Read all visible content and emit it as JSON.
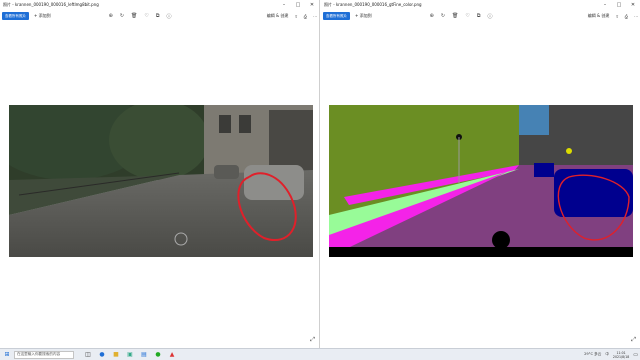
{
  "left_window": {
    "title": "照片 - krannen_000190_000016_leftImg8bit.png",
    "primary_button": "查看所有照片",
    "edit_label": "+ 添加到",
    "zoom_label": "编辑 & 创建",
    "share_label": "共享",
    "print_label": "打印"
  },
  "right_window": {
    "title": "照片 - krannen_000190_000016_gtFine_color.png",
    "primary_button": "查看所有照片",
    "edit_label": "+ 添加到",
    "zoom_label": "编辑 & 创建",
    "share_label": "共享",
    "print_label": "打印"
  },
  "icons": [
    "zoom-in-icon",
    "rotate-icon",
    "delete-icon",
    "favorite-icon",
    "crop-icon",
    "info-icon",
    "share-icon",
    "print-icon",
    "more-icon",
    "expand-icon"
  ],
  "colors": {
    "accent": "#1f6fd6",
    "road_seg": "#804080",
    "sidewalk_seg": "#f423e8",
    "vegetation_seg": "#6b8e23",
    "car_seg": "#00008e",
    "building_seg": "#464646",
    "sky_seg": "#4682b4",
    "terrain_seg": "#98fb98",
    "annotation_circle": "#e0202a"
  },
  "taskbar": {
    "search_placeholder": "在这里输入你要搜索的内容",
    "time": "11:01",
    "date": "2021/8/18",
    "temperature": "29°C 多云",
    "language": "中"
  }
}
